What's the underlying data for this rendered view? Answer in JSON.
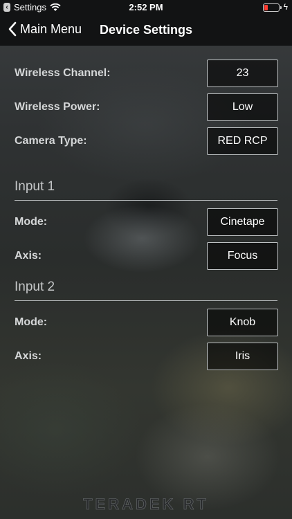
{
  "status_bar": {
    "back_app": "Settings",
    "time": "2:52 PM"
  },
  "nav": {
    "back_label": "Main Menu",
    "title": "Device Settings"
  },
  "general": {
    "wireless_channel": {
      "label": "Wireless Channel:",
      "value": "23"
    },
    "wireless_power": {
      "label": "Wireless Power:",
      "value": "Low"
    },
    "camera_type": {
      "label": "Camera Type:",
      "value": "RED RCP"
    }
  },
  "input1": {
    "title": "Input 1",
    "mode": {
      "label": "Mode:",
      "value": "Cinetape"
    },
    "axis": {
      "label": "Axis:",
      "value": "Focus"
    }
  },
  "input2": {
    "title": "Input 2",
    "mode": {
      "label": "Mode:",
      "value": "Knob"
    },
    "axis": {
      "label": "Axis:",
      "value": "Iris"
    }
  },
  "footer": {
    "logo_text": "TERADEK RT"
  },
  "colors": {
    "battery_low": "#ff3b30",
    "nav_bg": "#121314"
  }
}
